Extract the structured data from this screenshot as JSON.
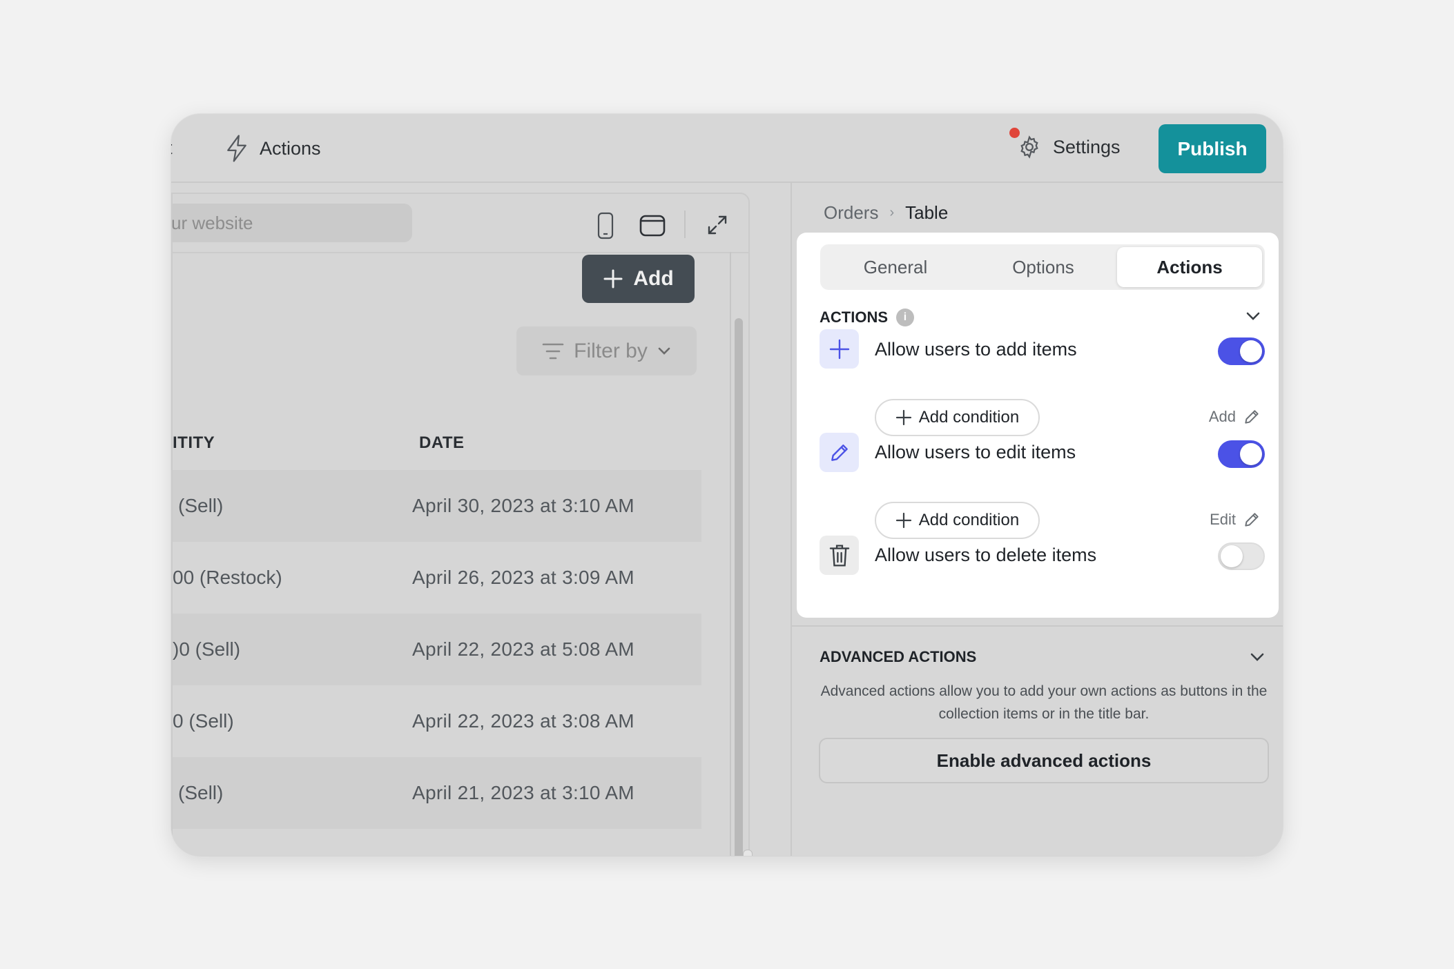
{
  "topbar": {
    "cut_text": "t",
    "actions_label": "Actions",
    "settings_label": "Settings",
    "publish_label": "Publish"
  },
  "preview": {
    "url_placeholder": "ur website",
    "add_label": "Add",
    "filter_label": "Filter by",
    "columns": {
      "quantity": "ITITY",
      "date": "DATE"
    },
    "rows": [
      {
        "quantity": "(Sell)",
        "date": "April 30, 2023 at 3:10 AM"
      },
      {
        "quantity": "00 (Restock)",
        "date": "April 26, 2023 at 3:09 AM"
      },
      {
        "quantity": ")0 (Sell)",
        "date": "April 22, 2023 at 5:08 AM"
      },
      {
        "quantity": "0 (Sell)",
        "date": "April 22, 2023 at 3:08 AM"
      },
      {
        "quantity": "(Sell)",
        "date": "April 21, 2023 at 3:10 AM"
      }
    ]
  },
  "panel": {
    "breadcrumb": {
      "parent": "Orders",
      "current": "Table"
    },
    "tabs": [
      "General",
      "Options",
      "Actions"
    ],
    "active_tab": "Actions",
    "actions_section": {
      "title": "ACTIONS",
      "items": [
        {
          "label": "Allow users to add items",
          "enabled": true,
          "condition_label": "Add condition",
          "link_label": "Add"
        },
        {
          "label": "Allow users to edit items",
          "enabled": true,
          "condition_label": "Add condition",
          "link_label": "Edit"
        },
        {
          "label": "Allow users to delete items",
          "enabled": false
        }
      ]
    },
    "advanced": {
      "title": "ADVANCED ACTIONS",
      "description": "Advanced actions allow you to add your own actions as buttons in the collection items or in the title bar.",
      "button_label": "Enable advanced actions"
    }
  },
  "colors": {
    "publish": "#14919b",
    "toggle_on": "#4b52e6",
    "notification_dot": "#e0453a"
  }
}
